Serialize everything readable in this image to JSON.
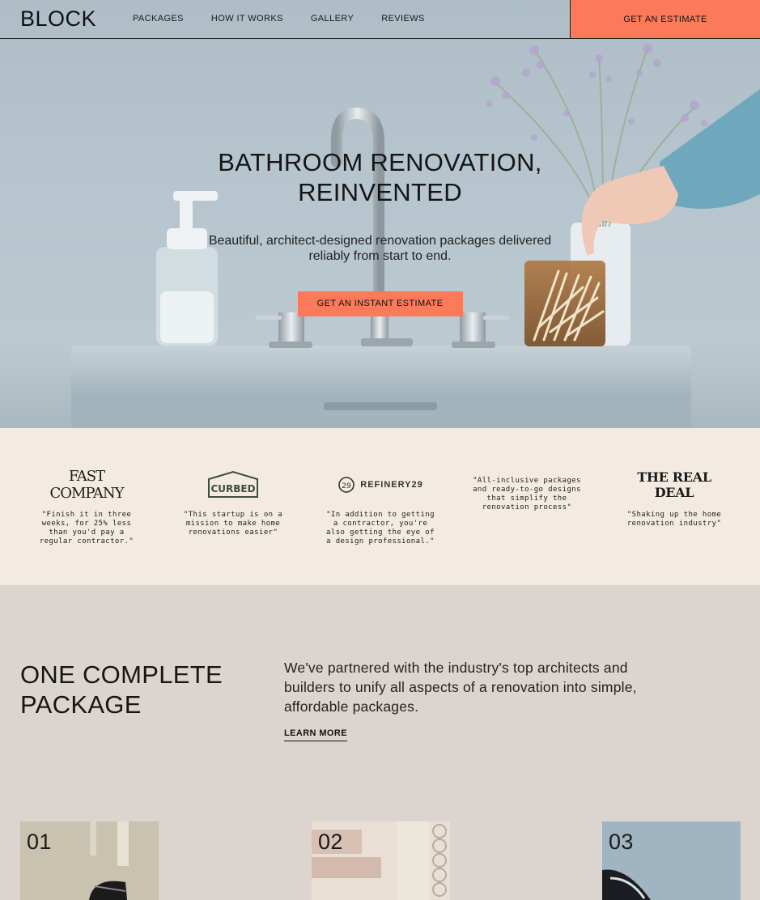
{
  "nav": {
    "logo": "BLOCK",
    "links": [
      "PACKAGES",
      "HOW IT WORKS",
      "GALLERY",
      "REVIEWS"
    ],
    "cta": "GET AN ESTIMATE"
  },
  "hero": {
    "title": "BATHROOM RENOVATION, REINVENTED",
    "subtitle": "Beautiful, architect-designed renovation packages delivered reliably from start to end.",
    "cta": "GET AN INSTANT ESTIMATE"
  },
  "press": [
    {
      "logo": "FAST COMPANY",
      "quote": "\"Finish it in three weeks, for 25% less than you'd pay a regular contractor.\""
    },
    {
      "logo": "CURBED",
      "quote": "\"This startup is on a mission to make home renovations easier\""
    },
    {
      "logo": "REFINERY29",
      "quote": "\"In addition to getting a contractor, you're also getting the eye of a design professional.\""
    },
    {
      "logo": "",
      "quote": "\"All-inclusive packages and ready-to-go designs that simplify the renovation process\""
    },
    {
      "logo": "THE REAL DEAL",
      "quote": "\"Shaking up the home renovation industry\""
    }
  ],
  "package": {
    "title": "ONE COMPLETE PACKAGE",
    "description": "We've partnered with the industry's top architects and builders to unify all aspects of a renovation into simple, affordable packages.",
    "link": "LEARN MORE",
    "tiles": [
      "01",
      "02",
      "03"
    ]
  },
  "colors": {
    "accent": "#fb7a5a",
    "press_bg": "#f3ebe1",
    "section_bg": "#dcd5cf"
  }
}
